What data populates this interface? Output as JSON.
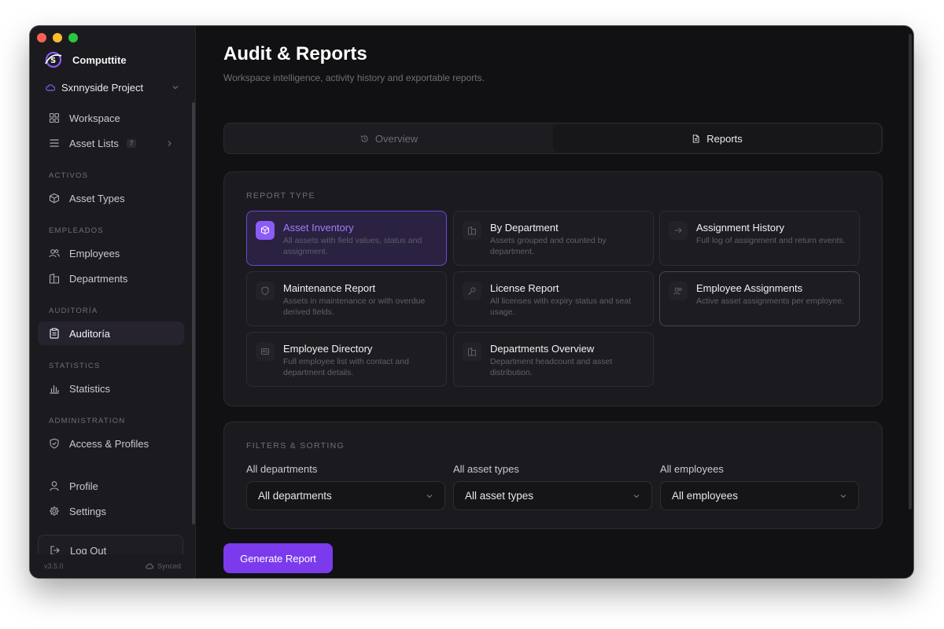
{
  "app": {
    "name": "Computtite",
    "project": "Sxnnyside Project",
    "version": "v3.5.0",
    "sync_status": "Synced"
  },
  "sidebar": {
    "top_items": [
      {
        "label": "Workspace",
        "icon": "grid-icon"
      },
      {
        "label": "Asset Lists",
        "icon": "list-icon",
        "badge": "7"
      }
    ],
    "sections": [
      {
        "label": "ACTIVOS",
        "items": [
          {
            "label": "Asset Types",
            "icon": "cube-icon"
          }
        ]
      },
      {
        "label": "EMPLEADOS",
        "items": [
          {
            "label": "Employees",
            "icon": "users-icon"
          },
          {
            "label": "Departments",
            "icon": "building-icon"
          }
        ]
      },
      {
        "label": "AUDITORÍA",
        "items": [
          {
            "label": "Auditoría",
            "icon": "clipboard-icon",
            "active": true
          }
        ]
      },
      {
        "label": "STATISTICS",
        "items": [
          {
            "label": "Statistics",
            "icon": "bar-chart-icon"
          }
        ]
      },
      {
        "label": "ADMINISTRATION",
        "items": [
          {
            "label": "Access & Profiles",
            "icon": "shield-icon"
          }
        ]
      }
    ],
    "bottom_items": [
      {
        "label": "Profile",
        "icon": "user-icon"
      },
      {
        "label": "Settings",
        "icon": "gear-icon"
      }
    ],
    "logout_label": "Log Out"
  },
  "header": {
    "title": "Audit & Reports",
    "subtitle": "Workspace intelligence, activity history and exportable reports."
  },
  "tabs": [
    {
      "label": "Overview",
      "icon": "history-icon",
      "active": false
    },
    {
      "label": "Reports",
      "icon": "document-icon",
      "active": true
    }
  ],
  "report_type": {
    "label": "REPORT TYPE",
    "cards": [
      {
        "title": "Asset Inventory",
        "desc": "All assets with field values, status and assignment.",
        "icon": "cube-icon",
        "selected": true
      },
      {
        "title": "By Department",
        "desc": "Assets grouped and counted by department.",
        "icon": "building-icon"
      },
      {
        "title": "Assignment History",
        "desc": "Full log of assignment and return events.",
        "icon": "arrow-right-icon"
      },
      {
        "title": "Maintenance Report",
        "desc": "Assets in maintenance or with overdue derived fields.",
        "icon": "shield-icon"
      },
      {
        "title": "License Report",
        "desc": "All licenses with expiry status and seat usage.",
        "icon": "key-icon"
      },
      {
        "title": "Employee Assignments",
        "desc": "Active asset assignments per employee.",
        "icon": "users-icon"
      },
      {
        "title": "Employee Directory",
        "desc": "Full employee list with contact and department details.",
        "icon": "id-card-icon"
      },
      {
        "title": "Departments Overview",
        "desc": "Department headcount and asset distribution.",
        "icon": "building-icon"
      }
    ]
  },
  "filters": {
    "label": "FILTERS & SORTING",
    "fields": [
      {
        "label": "All departments",
        "value": "All departments"
      },
      {
        "label": "All asset types",
        "value": "All asset types"
      },
      {
        "label": "All employees",
        "value": "All employees"
      }
    ]
  },
  "generate_button": "Generate Report",
  "colors": {
    "accent": "#7c3aed",
    "accent_text": "#a07cff",
    "background": "#111114",
    "sidebar": "#1b1b1f"
  }
}
